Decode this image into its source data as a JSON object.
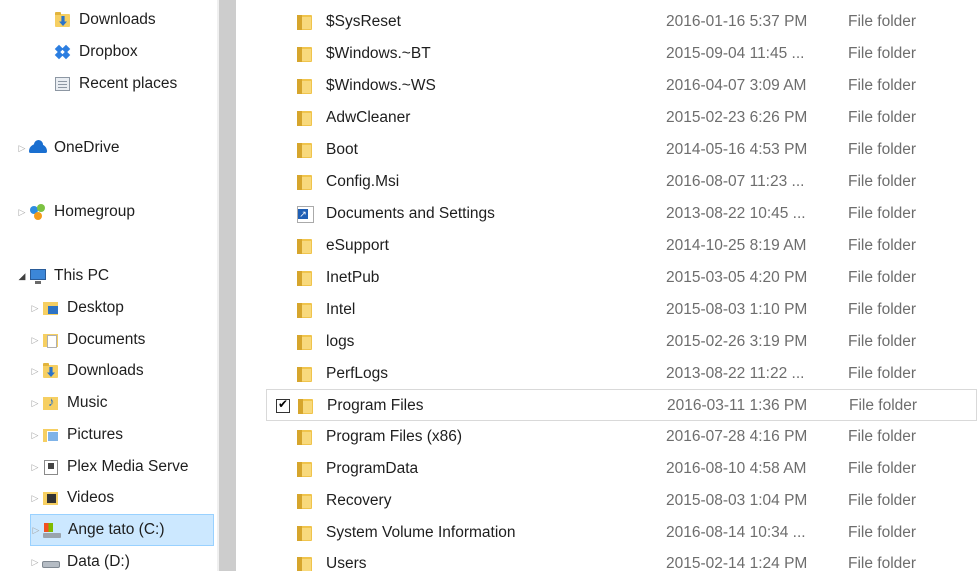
{
  "navigation": {
    "items": [
      {
        "label": "Downloads",
        "icon": "downloads-folder-icon"
      },
      {
        "label": "Dropbox",
        "icon": "dropbox-icon"
      },
      {
        "label": "Recent places",
        "icon": "recent-places-icon"
      },
      {
        "label": "OneDrive",
        "icon": "onedrive-icon"
      },
      {
        "label": "Homegroup",
        "icon": "homegroup-icon"
      },
      {
        "label": "This PC",
        "icon": "computer-icon"
      },
      {
        "label": "Desktop",
        "icon": "desktop-folder-icon"
      },
      {
        "label": "Documents",
        "icon": "documents-folder-icon"
      },
      {
        "label": "Downloads",
        "icon": "downloads-folder-icon"
      },
      {
        "label": "Music",
        "icon": "music-folder-icon"
      },
      {
        "label": "Pictures",
        "icon": "pictures-folder-icon"
      },
      {
        "label": "Plex Media Serve",
        "icon": "plex-media-server-icon"
      },
      {
        "label": "Videos",
        "icon": "videos-folder-icon"
      },
      {
        "label": "Ange tato (C:)",
        "icon": "windows-drive-icon"
      },
      {
        "label": "Data (D:)",
        "icon": "drive-icon"
      }
    ],
    "selected": "Ange tato (C:)"
  },
  "file_list": {
    "rows": [
      {
        "name": "$SysReset",
        "date": "2016-01-16 5:37 PM",
        "type": "File folder",
        "icon": "folder-icon"
      },
      {
        "name": "$Windows.~BT",
        "date": "2015-09-04 11:45 ...",
        "type": "File folder",
        "icon": "folder-icon"
      },
      {
        "name": "$Windows.~WS",
        "date": "2016-04-07 3:09 AM",
        "type": "File folder",
        "icon": "folder-icon"
      },
      {
        "name": "AdwCleaner",
        "date": "2015-02-23 6:26 PM",
        "type": "File folder",
        "icon": "folder-icon"
      },
      {
        "name": "Boot",
        "date": "2014-05-16 4:53 PM",
        "type": "File folder",
        "icon": "folder-icon"
      },
      {
        "name": "Config.Msi",
        "date": "2016-08-07 11:23 ...",
        "type": "File folder",
        "icon": "folder-icon"
      },
      {
        "name": "Documents and Settings",
        "date": "2013-08-22 10:45 ...",
        "type": "File folder",
        "icon": "shortcut-icon"
      },
      {
        "name": "eSupport",
        "date": "2014-10-25 8:19 AM",
        "type": "File folder",
        "icon": "folder-icon"
      },
      {
        "name": "InetPub",
        "date": "2015-03-05 4:20 PM",
        "type": "File folder",
        "icon": "folder-icon"
      },
      {
        "name": "Intel",
        "date": "2015-08-03 1:10 PM",
        "type": "File folder",
        "icon": "folder-icon"
      },
      {
        "name": "logs",
        "date": "2015-02-26 3:19 PM",
        "type": "File folder",
        "icon": "folder-icon"
      },
      {
        "name": "PerfLogs",
        "date": "2013-08-22 11:22 ...",
        "type": "File folder",
        "icon": "folder-icon"
      },
      {
        "name": "Program Files",
        "date": "2016-03-11 1:36 PM",
        "type": "File folder",
        "icon": "folder-icon",
        "checked": true
      },
      {
        "name": "Program Files (x86)",
        "date": "2016-07-28 4:16 PM",
        "type": "File folder",
        "icon": "folder-icon"
      },
      {
        "name": "ProgramData",
        "date": "2016-08-10 4:58 AM",
        "type": "File folder",
        "icon": "folder-icon"
      },
      {
        "name": "Recovery",
        "date": "2015-08-03 1:04 PM",
        "type": "File folder",
        "icon": "folder-icon"
      },
      {
        "name": "System Volume Information",
        "date": "2016-08-14 10:34 ...",
        "type": "File folder",
        "icon": "folder-icon"
      },
      {
        "name": "Users",
        "date": "2015-02-14 1:24 PM",
        "type": "File folder",
        "icon": "folder-icon"
      }
    ]
  },
  "colors": {
    "selection_fill": "#cce8ff",
    "selection_border": "#99d1ff",
    "secondary_text": "#6d6d6d",
    "folder_yellow": "#f0c44c"
  }
}
